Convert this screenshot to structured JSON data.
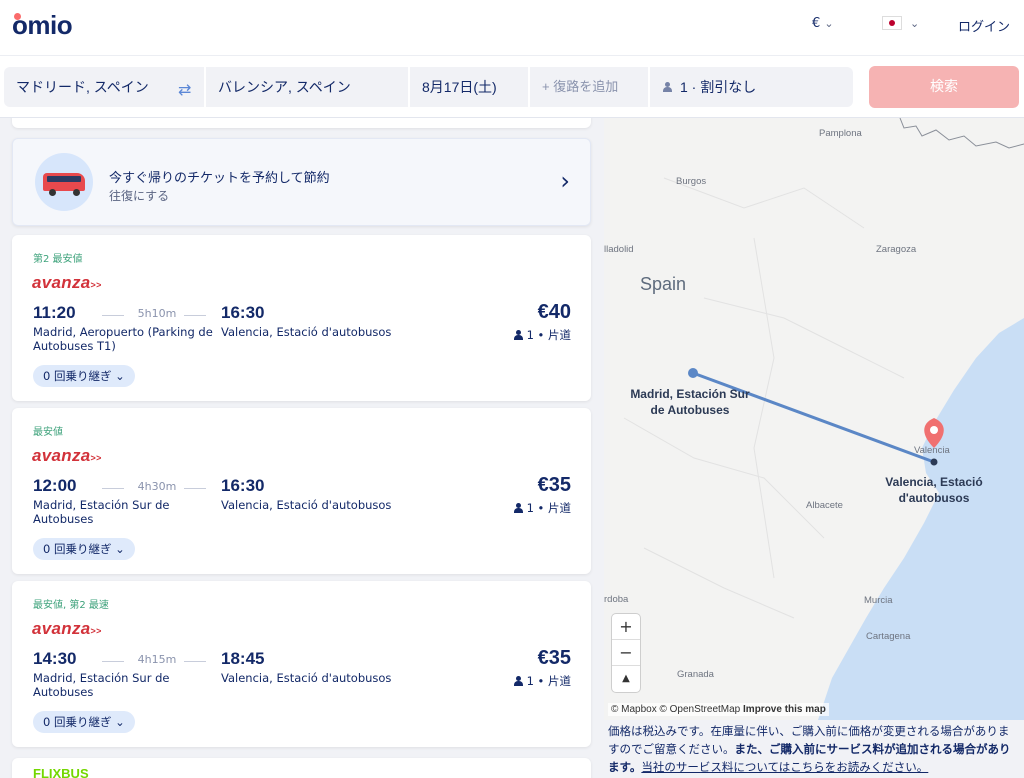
{
  "header": {
    "logo": "omio",
    "currency": "€",
    "login": "ログイン"
  },
  "search": {
    "from": "マドリード, スペイン",
    "to": "バレンシア, スペイン",
    "date": "8月17日(土)",
    "return_placeholder": "+ 復路を追加",
    "passengers": "1 · 割引なし",
    "search_button": "検索"
  },
  "promo": {
    "title": "今すぐ帰りのチケットを予約して節約",
    "subtitle": "往復にする"
  },
  "results": [
    {
      "badge": "第2 最安値",
      "brand": "avanza",
      "dep_time": "11:20",
      "duration": "5h10m",
      "arr_time": "16:30",
      "dep_station": "Madrid, Aeropuerto (Parking de Autobuses T1)",
      "arr_station": "Valencia, Estació d'autobusos",
      "price": "€40",
      "pax": "1 • 片道",
      "transfers": "0 回乗り継ぎ"
    },
    {
      "badge": "最安値",
      "brand": "avanza",
      "dep_time": "12:00",
      "duration": "4h30m",
      "arr_time": "16:30",
      "dep_station": "Madrid, Estación Sur de Autobuses",
      "arr_station": "Valencia, Estació d'autobusos",
      "price": "€35",
      "pax": "1 • 片道",
      "transfers": "0 回乗り継ぎ"
    },
    {
      "badge": "最安値, 第2 最速",
      "brand": "avanza",
      "dep_time": "14:30",
      "duration": "4h15m",
      "arr_time": "18:45",
      "dep_station": "Madrid, Estación Sur de Autobuses",
      "arr_station": "Valencia, Estació d'autobusos",
      "price": "€35",
      "pax": "1 • 片道",
      "transfers": "0 回乗り継ぎ"
    }
  ],
  "next_brand": "FLIXBUS",
  "map": {
    "country": "Spain",
    "places": [
      "Pamplona",
      "Burgos",
      "lladolid",
      "Zaragoza",
      "Valencia",
      "Albacete",
      "rdoba",
      "Murcia",
      "Cartagena",
      "Granada"
    ],
    "origin_label": "Madrid, Estación Sur de Autobuses",
    "dest_label": "Valencia, Estació d'autobusos",
    "attribution": "© Mapbox © OpenStreetMap",
    "improve": "Improve this map"
  },
  "notice": {
    "text1": "価格は税込みです。在庫量に伴い、ご購入前に価格が変更される場合がありますのでご留意ください。",
    "text2": "また、ご購入前にサービス料が追加される場合があります。",
    "link": "当社のサービス料についてはこちらをお読みください。"
  },
  "colors": {
    "navy": "#132968",
    "accent_red": "#fa6b6b",
    "search_btn_disabled": "#f6b3b3",
    "route_line": "#5b87c6",
    "sea": "#c9def5"
  }
}
